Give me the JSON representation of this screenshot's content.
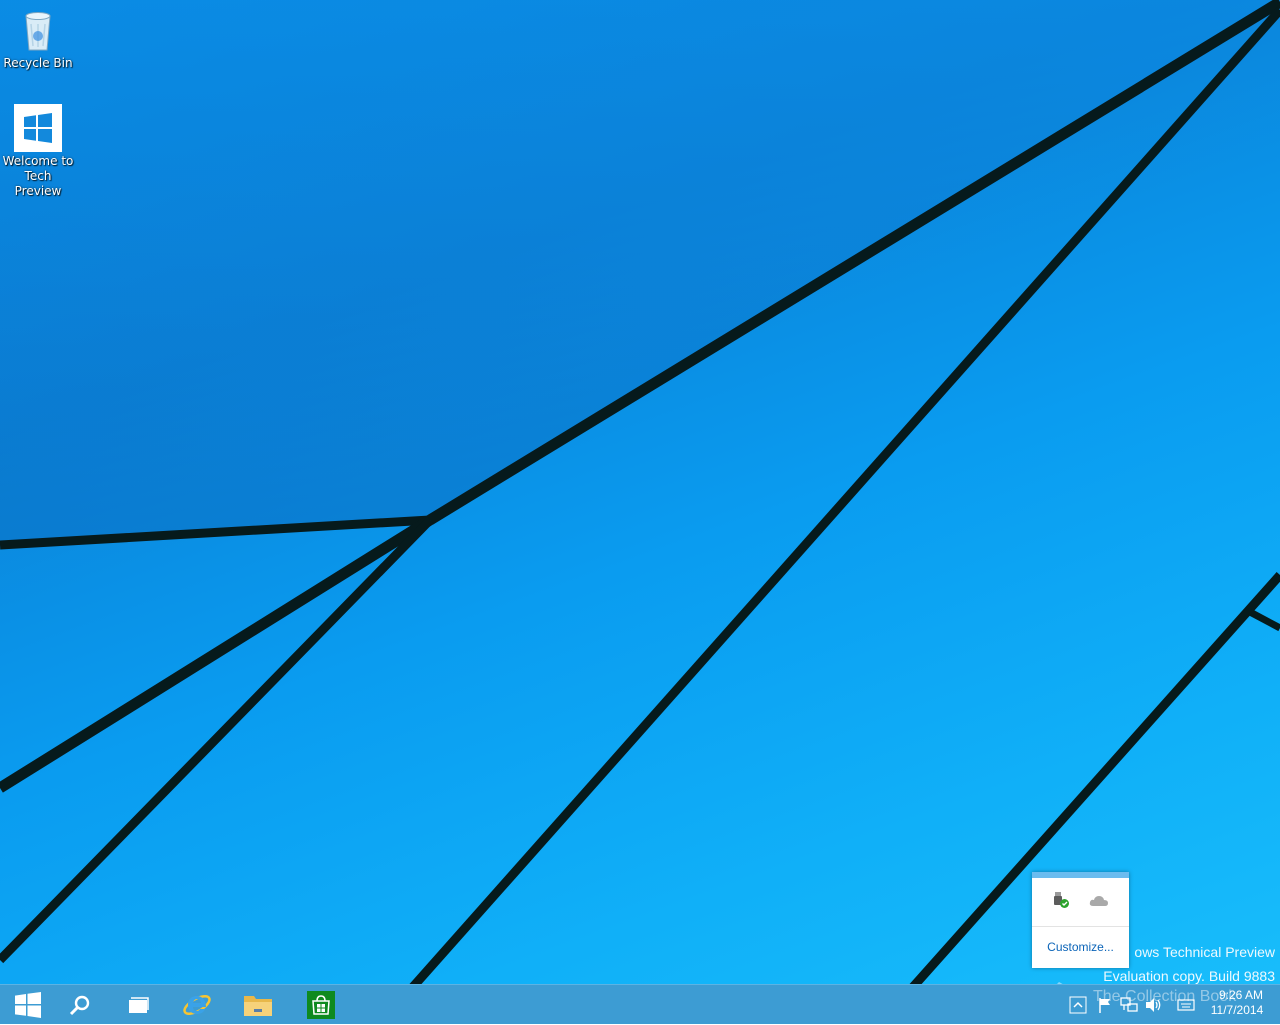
{
  "desktop": {
    "icons": [
      {
        "label_line1": "Recycle Bin",
        "label_line2": "",
        "icon": "recycle-bin-icon"
      },
      {
        "label_line1": "Welcome to",
        "label_line2": "Tech Preview",
        "icon": "windows-logo-icon"
      }
    ],
    "watermark": {
      "line1": "ows Technical Preview",
      "line2": "Evaluation copy. Build 9883",
      "line3": "The Collection Book"
    }
  },
  "tray_overflow": {
    "icons": [
      "usb-safely-remove-icon",
      "onedrive-cloud-icon"
    ],
    "customize_label": "Customize..."
  },
  "taskbar": {
    "buttons": [
      {
        "name": "start",
        "icon": "windows-logo-icon"
      },
      {
        "name": "search",
        "icon": "search-icon"
      },
      {
        "name": "task-view",
        "icon": "task-view-icon"
      },
      {
        "name": "internet-explorer",
        "icon": "ie-icon"
      },
      {
        "name": "file-explorer",
        "icon": "folder-icon"
      },
      {
        "name": "store",
        "icon": "store-icon"
      }
    ],
    "tray": [
      "chevron-up-icon",
      "flag-icon",
      "network-icon",
      "volume-icon",
      "keyboard-icon"
    ],
    "clock": {
      "time": "9:26 AM",
      "date": "11/7/2014"
    }
  },
  "colors": {
    "taskbar": "#3d9cd3",
    "accent": "#0b64b8",
    "store_green": "#0e8a1f"
  }
}
